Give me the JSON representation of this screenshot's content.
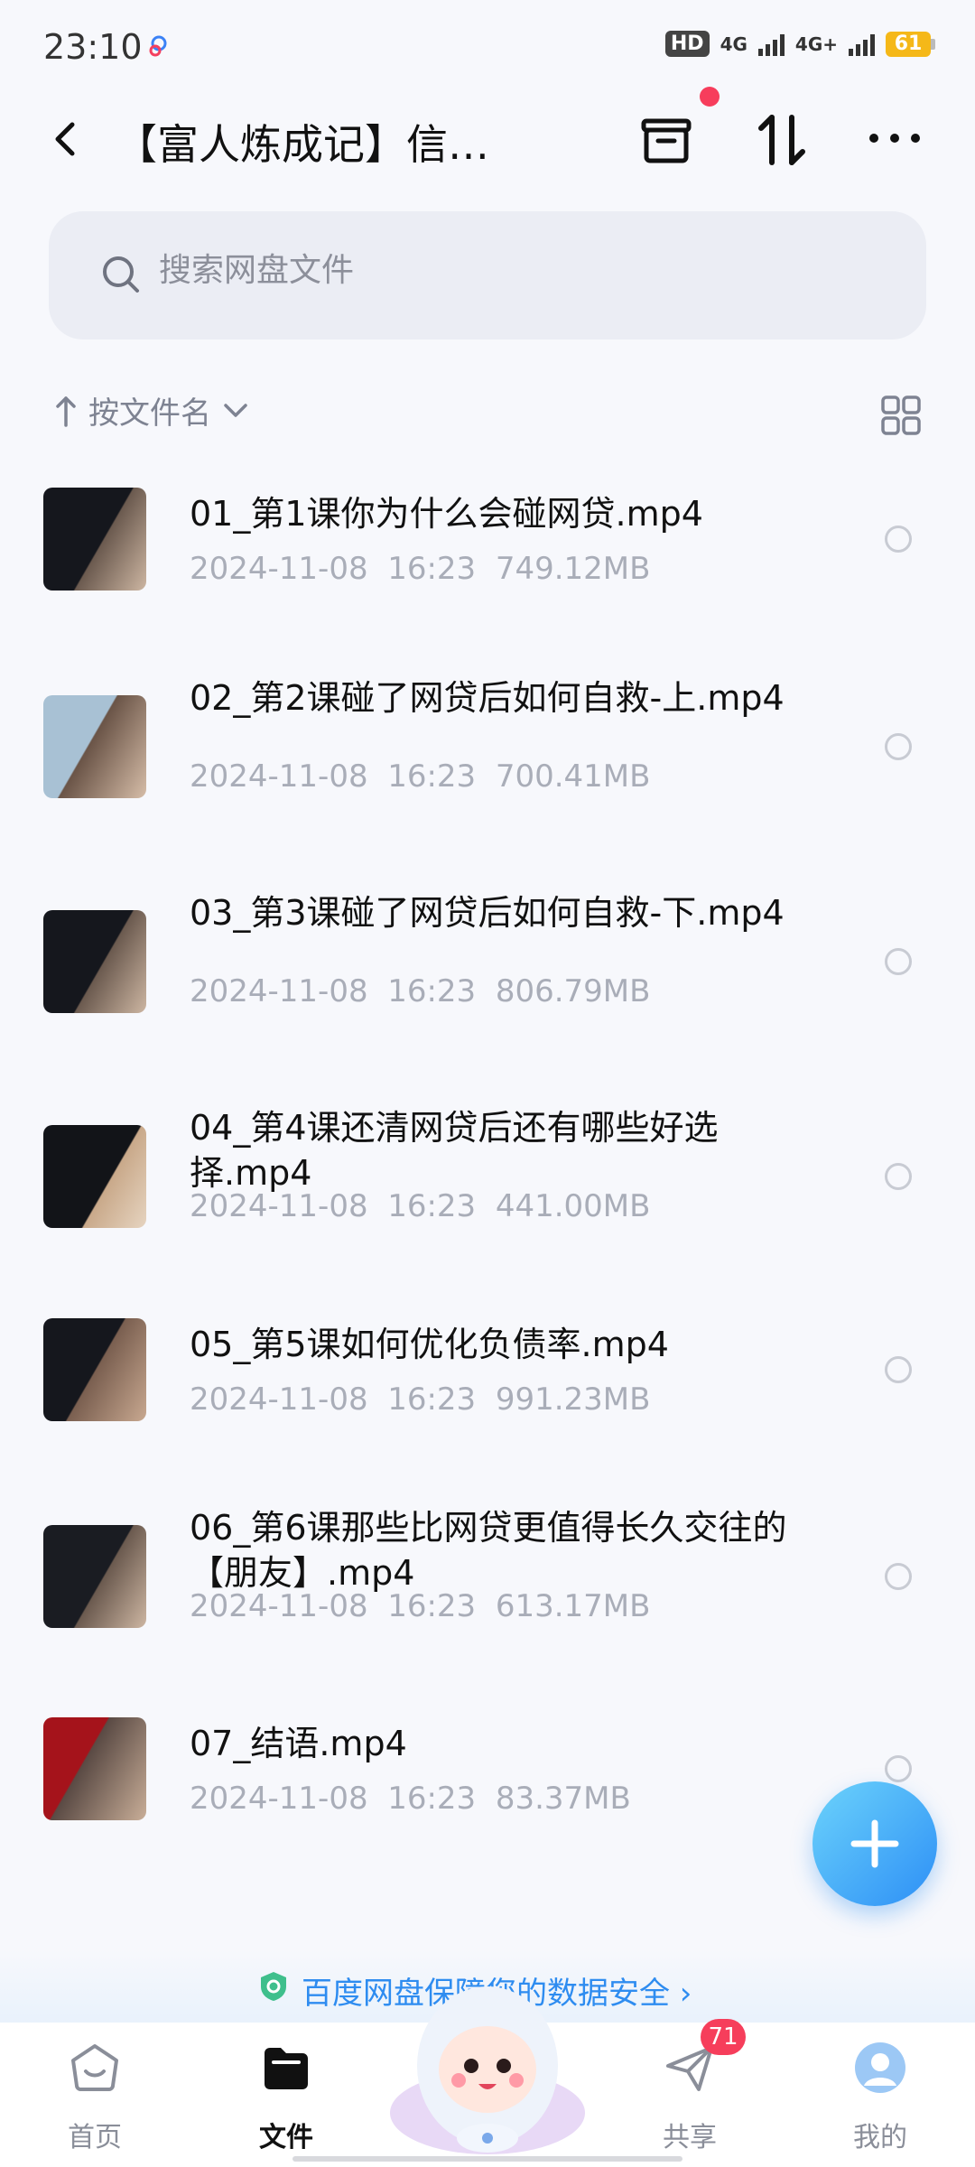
{
  "status_bar": {
    "time": "23:10",
    "hd": "HD",
    "network_1": "4G",
    "network_2": "4G+",
    "battery": "61"
  },
  "header": {
    "title": "【富人炼成记】信…"
  },
  "search": {
    "placeholder": "搜索网盘文件"
  },
  "sort": {
    "label": "按文件名"
  },
  "files": [
    {
      "name": "01_第1课你为什么会碰网贷.mp4",
      "date": "2024-11-08  16:23",
      "size": "749.12MB"
    },
    {
      "name": "02_第2课碰了网贷后如何自救-上.mp4",
      "date": "2024-11-08  16:23",
      "size": "700.41MB"
    },
    {
      "name": "03_第3课碰了网贷后如何自救-下.mp4",
      "date": "2024-11-08  16:23",
      "size": "806.79MB"
    },
    {
      "name": "04_第4课还清网贷后还有哪些好选择.mp4",
      "date": "2024-11-08  16:23",
      "size": "441.00MB"
    },
    {
      "name": "05_第5课如何优化负债率.mp4",
      "date": "2024-11-08  16:23",
      "size": "991.23MB"
    },
    {
      "name": "06_第6课那些比网贷更值得长久交往的【朋友】.mp4",
      "date": "2024-11-08  16:23",
      "size": "613.17MB"
    },
    {
      "name": "07_结语.mp4",
      "date": "2024-11-08  16:23",
      "size": "83.37MB"
    }
  ],
  "banner": {
    "text": "百度网盘保障您的数据安全 ›"
  },
  "nav": {
    "home": "首页",
    "files": "文件",
    "share": "共享",
    "share_badge": "71",
    "mine": "我的"
  },
  "colors": {
    "accent": "#2e8cf0",
    "badge": "#f63e5b",
    "battery": "#f5b818"
  },
  "icons": {
    "back": "back-arrow-icon",
    "recycle": "recycle-bin-icon",
    "transfer": "transfer-icon",
    "more": "more-icon",
    "search": "search-icon",
    "grid": "grid-view-icon",
    "add": "plus-icon"
  }
}
